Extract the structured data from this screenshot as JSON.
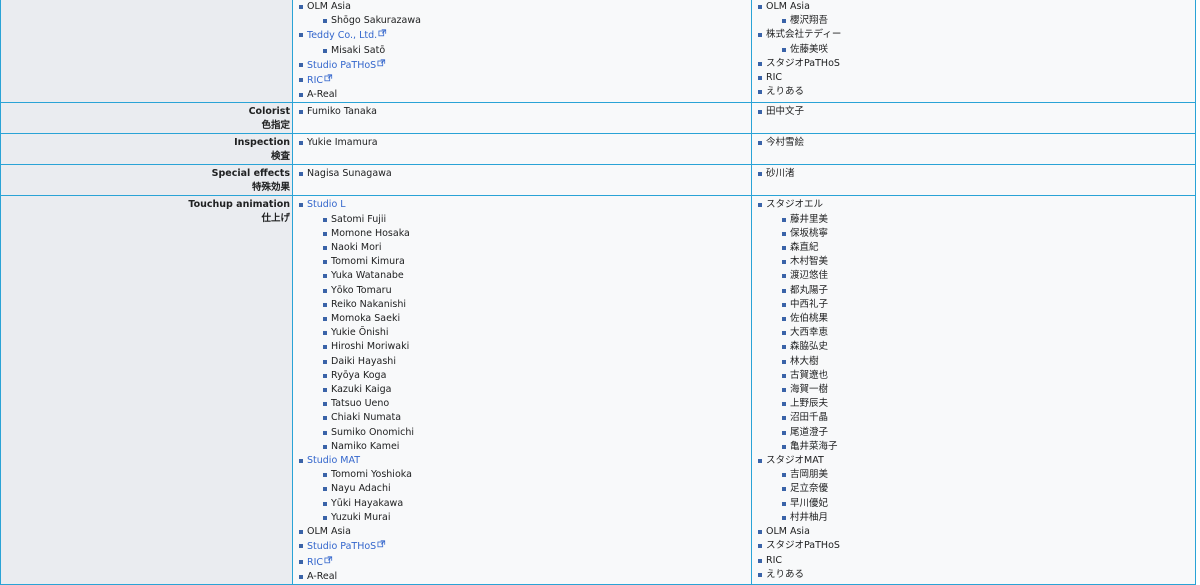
{
  "rows": [
    {
      "role_en": "",
      "role_ja": "",
      "en": [
        {
          "text": "OLM Asia",
          "link": false,
          "ext": false,
          "children": [
            {
              "text": "Shōgo Sakurazawa"
            }
          ]
        },
        {
          "text": "Teddy Co., Ltd.",
          "link": true,
          "ext": true,
          "children": [
            {
              "text": "Misaki Satō"
            }
          ]
        },
        {
          "text": "Studio PaTHoS",
          "link": true,
          "ext": true,
          "children": []
        },
        {
          "text": "RIC",
          "link": true,
          "ext": true,
          "children": []
        },
        {
          "text": "A-Real",
          "link": false,
          "ext": false,
          "children": []
        }
      ],
      "ja": [
        {
          "text": "OLM Asia",
          "children": [
            {
              "text": "櫻沢翔吾"
            }
          ]
        },
        {
          "text": "株式会社テディー",
          "children": [
            {
              "text": "佐藤美咲"
            }
          ]
        },
        {
          "text": "スタジオPaTHoS",
          "children": []
        },
        {
          "text": "RIC",
          "children": []
        },
        {
          "text": "えりある",
          "children": []
        }
      ]
    },
    {
      "role_en": "Colorist",
      "role_ja": "色指定",
      "en": [
        {
          "text": "Fumiko Tanaka",
          "link": false,
          "ext": false,
          "children": []
        }
      ],
      "ja": [
        {
          "text": "田中文子",
          "children": []
        }
      ]
    },
    {
      "role_en": "Inspection",
      "role_ja": "検査",
      "en": [
        {
          "text": "Yukie Imamura",
          "link": false,
          "ext": false,
          "children": []
        }
      ],
      "ja": [
        {
          "text": "今村雪絵",
          "children": []
        }
      ]
    },
    {
      "role_en": "Special effects",
      "role_ja": "特殊効果",
      "en": [
        {
          "text": "Nagisa Sunagawa",
          "link": false,
          "ext": false,
          "children": []
        }
      ],
      "ja": [
        {
          "text": "砂川渚",
          "children": []
        }
      ]
    },
    {
      "role_en": "Touchup animation",
      "role_ja": "仕上げ",
      "en": [
        {
          "text": "Studio L",
          "link": true,
          "ext": false,
          "children": [
            {
              "text": "Satomi Fujii"
            },
            {
              "text": "Momone Hosaka"
            },
            {
              "text": "Naoki Mori"
            },
            {
              "text": "Tomomi Kimura"
            },
            {
              "text": "Yuka Watanabe"
            },
            {
              "text": "Yōko Tomaru"
            },
            {
              "text": "Reiko Nakanishi"
            },
            {
              "text": "Momoka Saeki"
            },
            {
              "text": "Yukie Ōnishi"
            },
            {
              "text": "Hiroshi Moriwaki"
            },
            {
              "text": "Daiki Hayashi"
            },
            {
              "text": "Ryōya Koga"
            },
            {
              "text": "Kazuki Kaiga"
            },
            {
              "text": "Tatsuo Ueno"
            },
            {
              "text": "Chiaki Numata"
            },
            {
              "text": "Sumiko Onomichi"
            },
            {
              "text": "Namiko Kamei"
            }
          ]
        },
        {
          "text": "Studio MAT",
          "link": true,
          "ext": false,
          "children": [
            {
              "text": "Tomomi Yoshioka"
            },
            {
              "text": "Nayu Adachi"
            },
            {
              "text": "Yūki Hayakawa"
            },
            {
              "text": "Yuzuki Murai"
            }
          ]
        },
        {
          "text": "OLM Asia",
          "link": false,
          "ext": false,
          "children": []
        },
        {
          "text": "Studio PaTHoS",
          "link": true,
          "ext": true,
          "children": []
        },
        {
          "text": "RIC",
          "link": true,
          "ext": true,
          "children": []
        },
        {
          "text": "A-Real",
          "link": false,
          "ext": false,
          "children": []
        }
      ],
      "ja": [
        {
          "text": "スタジオエル",
          "children": [
            {
              "text": "藤井里美"
            },
            {
              "text": "保坂桃寧"
            },
            {
              "text": "森直紀"
            },
            {
              "text": "木村智美"
            },
            {
              "text": "渡辺悠佳"
            },
            {
              "text": "都丸陽子"
            },
            {
              "text": "中西礼子"
            },
            {
              "text": "佐伯桃果"
            },
            {
              "text": "大西幸恵"
            },
            {
              "text": "森脇弘史"
            },
            {
              "text": "林大樹"
            },
            {
              "text": "古賀遼也"
            },
            {
              "text": "海賀一樹"
            },
            {
              "text": "上野辰夫"
            },
            {
              "text": "沼田千晶"
            },
            {
              "text": "尾道澄子"
            },
            {
              "text": "亀井菜海子"
            }
          ]
        },
        {
          "text": "スタジオMAT",
          "children": [
            {
              "text": "吉岡朋美"
            },
            {
              "text": "足立奈優"
            },
            {
              "text": "早川優妃"
            },
            {
              "text": "村井柚月"
            }
          ]
        },
        {
          "text": "OLM Asia",
          "children": []
        },
        {
          "text": "スタジオPaTHoS",
          "children": []
        },
        {
          "text": "RIC",
          "children": []
        },
        {
          "text": "えりある",
          "children": []
        }
      ]
    }
  ]
}
